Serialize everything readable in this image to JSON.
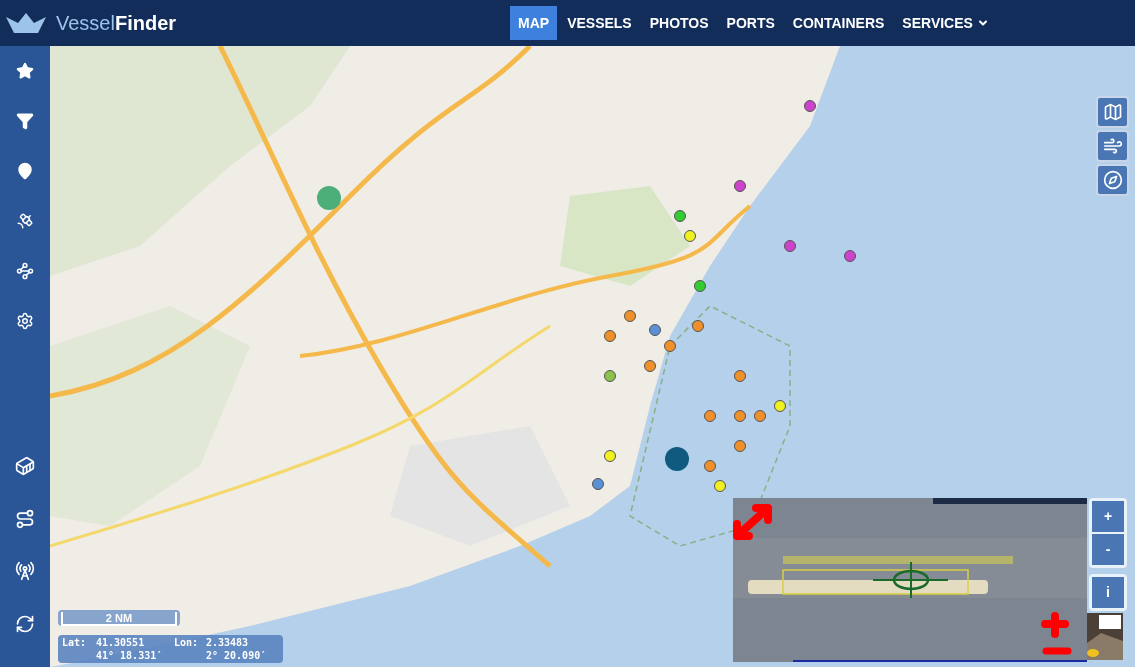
{
  "logo": {
    "light": "Vessel",
    "bold": "Finder"
  },
  "nav": [
    {
      "label": "MAP",
      "selected": true,
      "dropdown": false
    },
    {
      "label": "VESSELS",
      "selected": false,
      "dropdown": false
    },
    {
      "label": "PHOTOS",
      "selected": false,
      "dropdown": false
    },
    {
      "label": "PORTS",
      "selected": false,
      "dropdown": false
    },
    {
      "label": "CONTAINERS",
      "selected": false,
      "dropdown": false
    },
    {
      "label": "SERVICES",
      "selected": false,
      "dropdown": true
    }
  ],
  "zoom": {
    "in": "+",
    "out": "-",
    "info": "i"
  },
  "scale": "2 NM",
  "coordinates": {
    "lat_label": "Lat:",
    "lat": "41.30551",
    "lat_dms": "41° 18.331′",
    "lon_label": "Lon:",
    "lon": "2.33483",
    "lon_dms": "2° 20.090′"
  }
}
